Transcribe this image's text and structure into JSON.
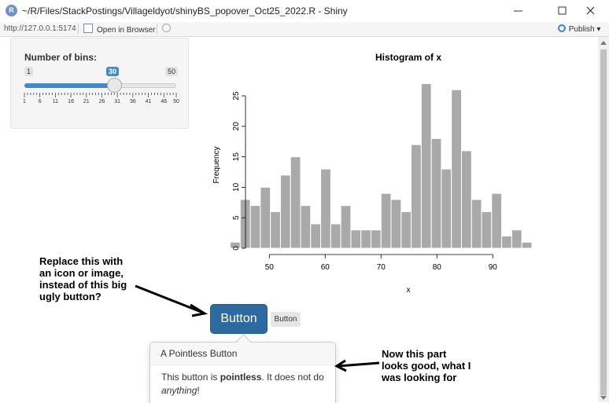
{
  "window": {
    "title": "~/R/Files/StackPostings/Villageldyot/shinyBS_popover_Oct25_2022.R - Shiny",
    "app_icon_letter": "R"
  },
  "toolbar": {
    "url": "http://127.0.0.1:5174",
    "open_in_browser": "Open in Browser",
    "publish": "Publish"
  },
  "slider": {
    "label": "Number of bins:",
    "min": 1,
    "max": 50,
    "value": 30,
    "min_label": "1",
    "max_label": "50",
    "value_label": "30",
    "tick_labels": [
      "1",
      "6",
      "11",
      "16",
      "21",
      "26",
      "31",
      "36",
      "41",
      "46",
      "50"
    ],
    "accent": "#428bca"
  },
  "chart_data": {
    "type": "bar",
    "title": "Histogram of x",
    "xlabel": "x",
    "ylabel": "Frequency",
    "bin_start": 43,
    "bin_width": 1.8,
    "values": [
      1,
      8,
      7,
      10,
      6,
      12,
      15,
      7,
      4,
      13,
      4,
      7,
      3,
      3,
      3,
      9,
      8,
      6,
      17,
      27,
      18,
      13,
      26,
      16,
      8,
      6,
      9,
      2,
      3,
      1
    ],
    "xticks": [
      50,
      60,
      70,
      80,
      90
    ],
    "xtick_labels": [
      "50",
      "60",
      "70",
      "80",
      "90"
    ],
    "yticks": [
      0,
      5,
      10,
      15,
      20,
      25
    ],
    "ytick_labels": [
      "0",
      "5",
      "10",
      "15",
      "20",
      "25"
    ],
    "xlim": [
      42.5,
      96.5
    ],
    "ylim": [
      0,
      27
    ],
    "bar_color": "#a9a9a9"
  },
  "buttons": {
    "big_label": "Button",
    "small_label": "Button",
    "accent": "#2c6aa0"
  },
  "popover": {
    "title": "A Pointless Button",
    "body_pre": "This button is ",
    "body_bold": "pointless",
    "body_mid": ". It does not do ",
    "body_italic": "anything",
    "body_post": "!"
  },
  "annotations": {
    "left_lines": [
      "Replace this with",
      "an icon or image,",
      "instead of this big",
      "ugly button?"
    ],
    "right_lines": [
      "Now this part",
      "looks good, what I",
      "was looking for"
    ]
  }
}
